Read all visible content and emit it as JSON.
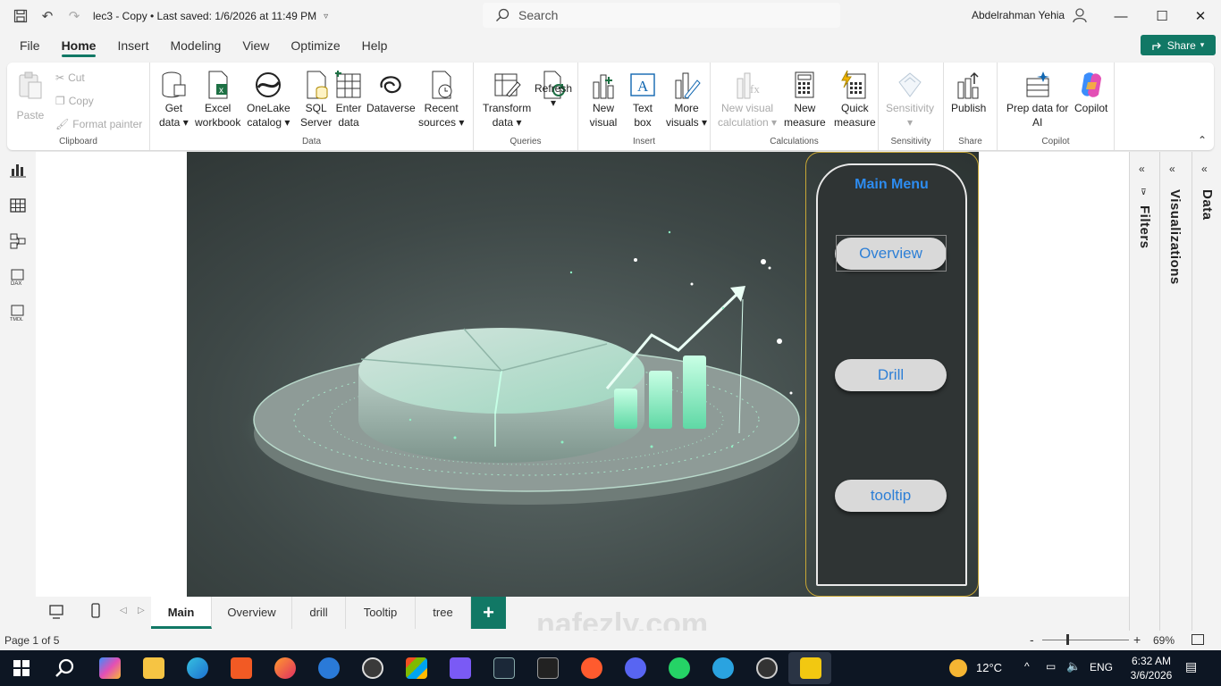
{
  "titlebar": {
    "doc_title": "lec3 - Copy • Last saved: 1/6/2026 at 11:49 PM",
    "search_placeholder": "Search",
    "user_name": "Abdelrahman Yehia"
  },
  "menu_tabs": [
    "File",
    "Home",
    "Insert",
    "Modeling",
    "View",
    "Optimize",
    "Help"
  ],
  "active_tab": "Home",
  "share_label": "Share",
  "ribbon": {
    "clipboard": {
      "label": "Clipboard",
      "paste": "Paste",
      "cut": "Cut",
      "copy": "Copy",
      "format_painter": "Format painter"
    },
    "data": {
      "label": "Data",
      "get_data": [
        "Get",
        "data"
      ],
      "excel": [
        "Excel",
        "workbook"
      ],
      "onelake": [
        "OneLake",
        "catalog"
      ],
      "sql": [
        "SQL",
        "Server"
      ],
      "enter": [
        "Enter",
        "data"
      ],
      "dataverse": "Dataverse",
      "recent": [
        "Recent",
        "sources"
      ]
    },
    "queries": {
      "label": "Queries",
      "transform": [
        "Transform",
        "data"
      ],
      "refresh": "Refresh"
    },
    "insert": {
      "label": "Insert",
      "new_visual": [
        "New",
        "visual"
      ],
      "text_box": [
        "Text",
        "box"
      ],
      "more_visuals": [
        "More",
        "visuals"
      ]
    },
    "calculations": {
      "label": "Calculations",
      "new_visual_calc": [
        "New visual",
        "calculation"
      ],
      "new_measure": [
        "New",
        "measure"
      ],
      "quick_measure": [
        "Quick",
        "measure"
      ]
    },
    "sensitivity": {
      "label": "Sensitivity",
      "btn": "Sensitivity"
    },
    "share": {
      "label": "Share",
      "publish": "Publish"
    },
    "copilot": {
      "label": "Copilot",
      "prep": [
        "Prep data for",
        "AI"
      ],
      "copilot": "Copilot"
    }
  },
  "report": {
    "menu_title": "Main Menu",
    "buttons": [
      "Overview",
      "Drill",
      "tooltip"
    ]
  },
  "panes": [
    "Filters",
    "Visualizations",
    "Data"
  ],
  "page_tabs": [
    "Main",
    "Overview",
    "drill",
    "Tooltip",
    "tree"
  ],
  "active_page": "Main",
  "status": {
    "page_count": "Page 1 of 5",
    "zoom": "69%",
    "zoom_fraction": 0.28
  },
  "taskbar": {
    "temperature": "12°C",
    "language": "ENG",
    "time": "6:32 AM",
    "date": "3/6/2026"
  },
  "watermark": "nafezly.com"
}
